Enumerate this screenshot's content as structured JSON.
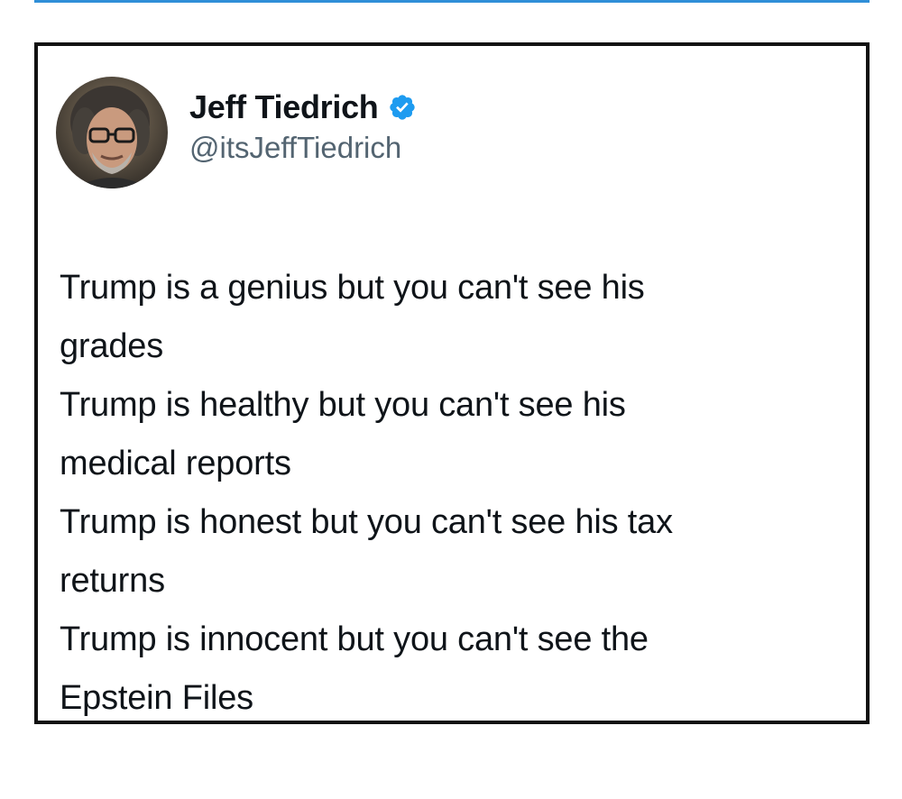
{
  "tweet": {
    "author": {
      "display_name": "Jeff Tiedrich",
      "handle": "@itsJeffTiedrich",
      "verified": true,
      "verified_icon": "verified-badge-icon"
    },
    "lines": [
      "Trump is a genius but you can't see his",
      "grades",
      "Trump is healthy but you can't see his",
      "medical reports",
      "Trump is honest but you can't see his tax",
      "returns",
      "Trump is innocent but you can't see the",
      "Epstein Files"
    ]
  },
  "colors": {
    "accent_rule": "#2f8fd8",
    "verified_blue": "#1d9bf0",
    "name_text": "#0f1419",
    "handle_text": "#536471",
    "card_border": "#111111"
  }
}
